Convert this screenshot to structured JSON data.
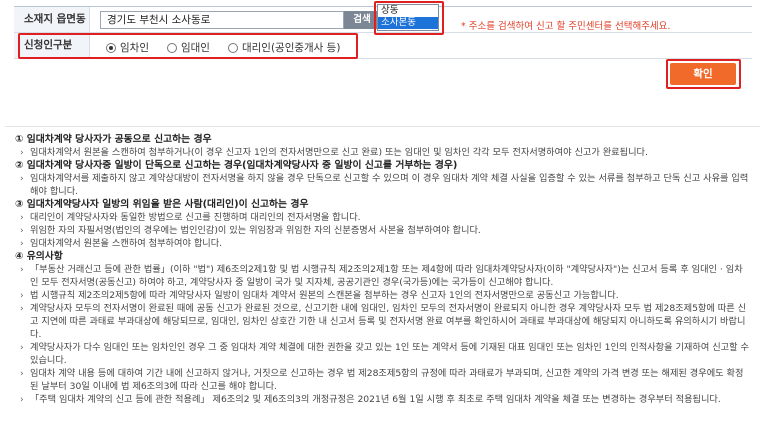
{
  "form": {
    "address_label": "소재지 읍면동",
    "address_value": "경기도 부천시  소사동로",
    "search_label": "검색",
    "dong_options": [
      "상동",
      "소사본동"
    ],
    "dong_selected_index": 1,
    "notice": "* 주소를 검색하여 신고 할 주민센터를 선택해주세요.",
    "applicant_label": "신청인구분",
    "applicant_options": [
      "임차인",
      "임대인",
      "대리인(공인중개사 등)"
    ],
    "applicant_selected_index": 0,
    "confirm_label": "확인"
  },
  "info": {
    "s1_title": "① 임대차계약 당사자가 공동으로 신고하는 경우",
    "s1_b1": "임대차계약서 원본을 스캔하여 첨부하거나(이 경우 신고자 1인의 전자서명만으로 신고 완료) 또는 임대인 및 임차인 각각 모두 전자서명하여야 신고가 완료됩니다.",
    "s2_title": "② 임대차계약 당사자중 일방이 단독으로 신고하는 경우(임대차계약당사자 중 일방이 신고를 거부하는 경우)",
    "s2_b1": "임대차계약서를 제출하지 않고 계약상대방이 전자서명을 하지 않을 경우 단독으로 신고할 수 있으며 이 경우 임대차 계약 체결 사실을 입증할 수 있는 서류를 첨부하고 단독 신고 사유를 입력해야 합니다.",
    "s3_title": "③ 임대차계약당사자 일방의 위임을 받은 사람(대리인)이 신고하는 경우",
    "s3_b1": "대리인이 계약당사자와 동일한 방법으로 신고를 진행하며 대리인의 전자서명을 합니다.",
    "s3_b2": "위임한 자의 자필서명(법인의 경우에는 법인인감)이 있는 위임장과 위임한 자의 신분증명서 사본을 첨부하여야 합니다.",
    "s3_b3": "임대차계약서 원본을 스캔하여 첨부하여야 합니다.",
    "s4_title": "④ 유의사항",
    "s4_b1": "「부동산 거래신고 등에 관한 법률」(이하 \"법\") 제6조의2제1항 및 법 시행규칙 제2조의2제1항 또는 제4항에 따라 임대차계약당사자(이하 \"계약당사자\")는 신고서 등록 후 임대인 · 임차인 모두 전자서명(공동신고) 하여야 하고, 계약당사자 중 일방이 국가 및 지자체, 공공기관인 경우(국가등)에는 국가등이 신고해야 합니다.",
    "s4_b2": "법 시행규칙 제2조의2제5항에 따라 계약당사자 일방이 임대차 계약서 원본의 스캔본을 첨부하는 경우 신고자 1인의 전자서명만으로 공동신고 가능합니다.",
    "s4_b3": "계약당사자 모두의 전자서명이 완료된 때에 공동 신고가 완료된 것으로, 신고기한 내에 임대인, 임차인 모두의 전자서명이 완료되지 아니한 경우 계약당사자 모두 법 제28조제5항에 따른 신고 지연에 따른 과태료 부과대상에 해당되므로, 임대인, 임차인 상호간 기한 내 신고서 등록 및 전자서명 완료 여부를 확인하시어 과태료 부과대상에 해당되지 아니하도록 유의하시기 바랍니다.",
    "s4_b4": "계약당사자가 다수 임대인 또는 임차인인 경우 그 중 임대차 계약 체결에 대한 권한을 갖고 있는 1인 또는 계약서 등에 기재된 대표 임대인 또는 임차인 1인의 인적사항을 기재하여 신고할 수 있습니다.",
    "s4_b5": "임대차 계약 내용 등에 대하여 기간 내에 신고하지 않거나, 거짓으로 신고하는 경우 법 제28조제5항의 규정에 따라 과태료가 부과되며, 신고한 계약의 가격 변경 또는 해제된 경우에도 확정된 날부터 30일 이내에 법 제6조의3에 따라 신고를 해야 합니다.",
    "s4_b6": "「주택 임대차 계약의 신고 등에 관한 적용례」 제6조의2 및 제6조의3의 개정규정은 2021년 6월 1일 시행 후 최초로 주택 임대차 계약을 체결 또는 변경하는 경우부터 적용됩니다."
  }
}
